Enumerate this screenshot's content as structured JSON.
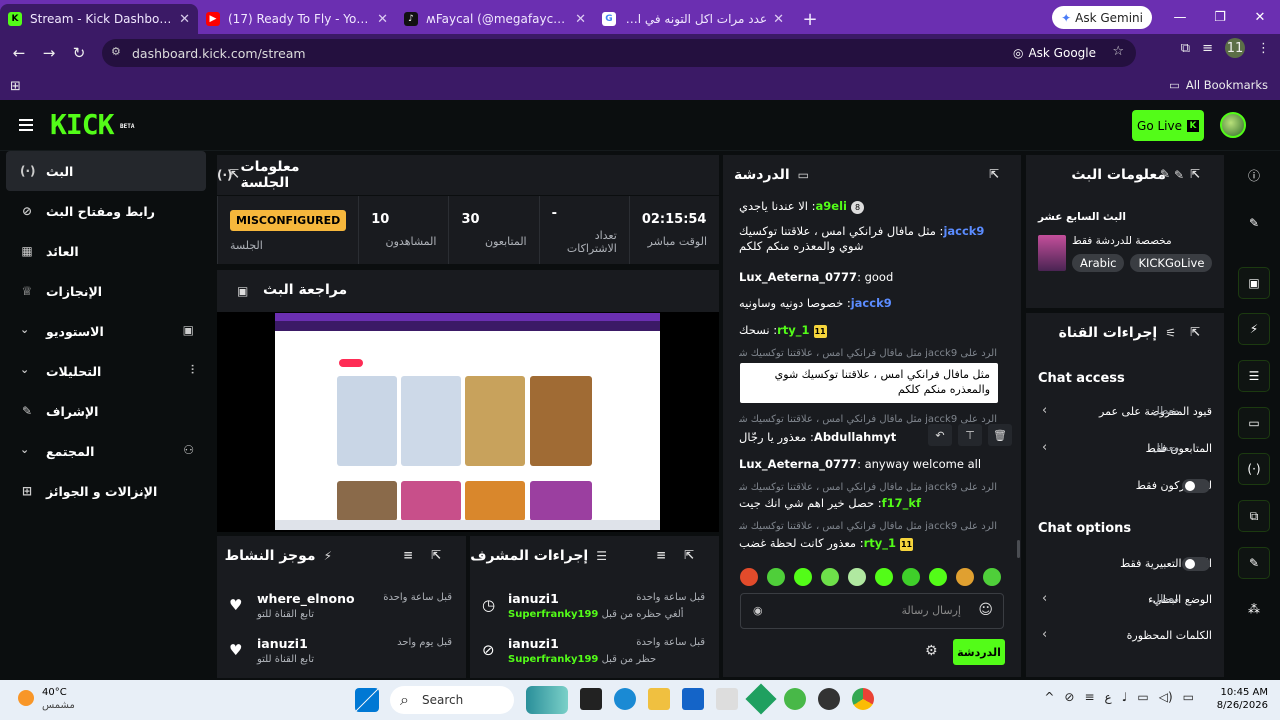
{
  "browser": {
    "tabs": [
      {
        "title": "Stream - Kick Dashboard",
        "fav_color": "#53fc18",
        "fav_char": "K",
        "active": true
      },
      {
        "title": "(17) Ready To Fly - YouTube",
        "fav_color": "#ff0000",
        "fav_char": "▶",
        "active": false
      },
      {
        "title": "ʍFaycal (@megafaycal) | TikTok",
        "fav_color": "#111111",
        "fav_char": "♪",
        "active": false
      },
      {
        "title": "عدد مرات اكل التونه في الاسبوع",
        "fav_color": "#ffffff",
        "fav_char": "G",
        "active": false
      }
    ],
    "new_tab": "+",
    "ask_gemini": "Ask Gemini",
    "url": "dashboard.kick.com/stream",
    "ask_google": "Ask Google",
    "profile_initials": "11",
    "all_bookmarks": "All Bookmarks"
  },
  "header": {
    "logo": "KICK",
    "logo_badge": "BETA",
    "go_live": "Go Live",
    "go_live_icon": "K"
  },
  "sidebar": {
    "items": [
      {
        "label": "البث",
        "icon": "stream-icon",
        "glyph": "(·)"
      },
      {
        "label": "رابط ومفتاح البث",
        "icon": "link-icon",
        "glyph": "⊘"
      },
      {
        "label": "العائد",
        "icon": "revenue-icon",
        "glyph": "▦"
      },
      {
        "label": "الإنجازات",
        "icon": "trophy-icon",
        "glyph": "♕"
      },
      {
        "label": "الاستوديو",
        "icon": "studio-icon",
        "glyph": "▣"
      },
      {
        "label": "التحليلات",
        "icon": "analytics-icon",
        "glyph": "⫶"
      },
      {
        "label": "الإشراف",
        "icon": "wrench-icon",
        "glyph": "✎"
      },
      {
        "label": "المجتمع",
        "icon": "community-icon",
        "glyph": "⚇"
      },
      {
        "label": "الإنزالات و الجوائز",
        "icon": "gift-icon",
        "glyph": "⊞"
      }
    ]
  },
  "session": {
    "title": "معلومات الجلسة",
    "stats": [
      {
        "value": "02:15:54",
        "label": "الوقت مباشر"
      },
      {
        "value": "-",
        "label": "تعداد الاشتراكات"
      },
      {
        "value": "30",
        "label": "المتابعون"
      },
      {
        "value": "10",
        "label": "المشاهدون"
      },
      {
        "value": "MISCONFIGURED",
        "label": "الجلسة"
      }
    ]
  },
  "preview": {
    "title": "مراجعة البث"
  },
  "activity": {
    "title": "موجز النشاط",
    "items": [
      {
        "name": "where_elnono",
        "sub": "تابع القناة للتو",
        "time": "قبل ساعة واحدة"
      },
      {
        "name": "ianuzi1",
        "sub": "تابع القناة للتو",
        "time": "قبل يوم واحد"
      }
    ]
  },
  "mod_actions": {
    "title": "إجراءات المشرف",
    "items": [
      {
        "name": "ianuzi1",
        "sub_pre": "ألغي حظره من قبل",
        "sub_user": "Superfranky199",
        "time": "قبل ساعة واحدة"
      },
      {
        "name": "ianuzi1",
        "sub_pre": "حظر من قبل",
        "sub_user": "Superfranky199",
        "time": "قبل ساعة واحدة"
      }
    ]
  },
  "chat": {
    "title": "الدردشة",
    "messages": [
      {
        "user": "a9eli",
        "color": "#53fc18",
        "text": "الا عندنا ياجدي"
      },
      {
        "user": "jacck9",
        "color": "#5b8cff",
        "text": "مثل مافال فرانكي امس ، علاقتنا توكسيك شوي والمعذره منكم كلكم"
      },
      {
        "user": "Lux_Aeterna_0777",
        "color": "#ffffff",
        "text": "good"
      },
      {
        "user": "jacck9",
        "color": "#5b8cff",
        "text": "خصوصا دونيه وساونيه"
      },
      {
        "user": "rty_1",
        "color": "#53fc18",
        "text": "نسحك"
      },
      {
        "user": "Abdullahmyt",
        "color": "#ffffff",
        "text": "معذور يا رجّال"
      },
      {
        "user": "Lux_Aeterna_0777",
        "color": "#ffffff",
        "text": "anyway welcome all"
      },
      {
        "user": "f17_kf",
        "color": "#53fc18",
        "text": "حصل خير اهم شي انك جيت"
      },
      {
        "user": "rty_1",
        "color": "#53fc18",
        "text": "معذور كانت لحظة غضب"
      }
    ],
    "reply_prefix": "الرد على",
    "reply_user": "jacck9",
    "reply_text": "مثل مافال فرانكي امس ، علاقتنا توكسيك شوي والمعذره منكم كلكم",
    "tooltip": "مثل مافال فرانكي امس ، علاقتنا توكسيك شوي والمعذره منكم كلكم",
    "badge": "11",
    "placeholder": "إرسال رسالة",
    "send": "الدردشة"
  },
  "stream_info": {
    "title": "معلومات البث",
    "stream_title": "البث السابع عشر",
    "category": "مخصصة للدردشة فقط",
    "tags": [
      "Arabic",
      "KICKGoLive"
    ]
  },
  "channel_actions": {
    "title": "إجراءات القناة",
    "chat_access": "Chat access",
    "rows": [
      {
        "label": "قيود المفروضة على عمر",
        "state": "معطل"
      },
      {
        "label": "المتابعون فقط",
        "state": "معطل"
      },
      {
        "label": "للمشتركون فقط",
        "state": ""
      }
    ],
    "chat_options": "Chat options",
    "rows2": [
      {
        "label": "الصور التعبيرية فقط",
        "state": ""
      },
      {
        "label": "الوضع البطيء",
        "state": "معطل"
      },
      {
        "label": "الكلمات المحظورة",
        "state": ""
      }
    ]
  },
  "taskbar": {
    "temp": "40°C",
    "weather": "مشمس",
    "search": "Search",
    "lang": "ع",
    "time": "10:45 AM",
    "date": "8/26/2026"
  }
}
